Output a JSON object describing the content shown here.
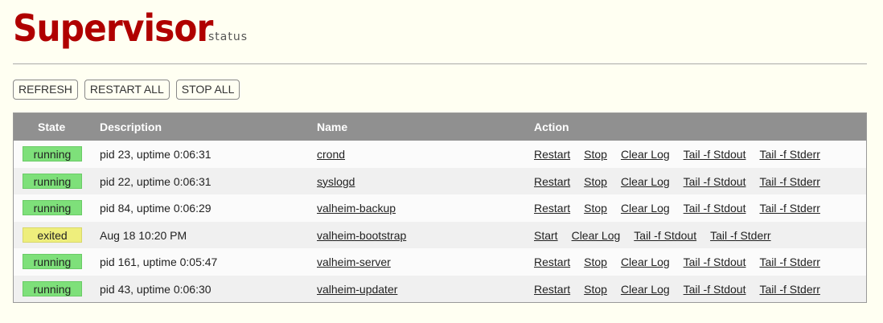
{
  "header": {
    "logo": "Supervisor",
    "subtitle": "status"
  },
  "toolbar": {
    "refresh_label": "REFRESH",
    "restart_all_label": "RESTART ALL",
    "stop_all_label": "STOP ALL"
  },
  "table": {
    "columns": {
      "state": "State",
      "description": "Description",
      "name": "Name",
      "action": "Action"
    },
    "rows": [
      {
        "state": "running",
        "description": "pid 23, uptime 0:06:31",
        "name": "crond",
        "actions": [
          "Restart",
          "Stop",
          "Clear Log",
          "Tail -f Stdout",
          "Tail -f Stderr"
        ]
      },
      {
        "state": "running",
        "description": "pid 22, uptime 0:06:31",
        "name": "syslogd",
        "actions": [
          "Restart",
          "Stop",
          "Clear Log",
          "Tail -f Stdout",
          "Tail -f Stderr"
        ]
      },
      {
        "state": "running",
        "description": "pid 84, uptime 0:06:29",
        "name": "valheim-backup",
        "actions": [
          "Restart",
          "Stop",
          "Clear Log",
          "Tail -f Stdout",
          "Tail -f Stderr"
        ]
      },
      {
        "state": "exited",
        "description": "Aug 18 10:20 PM",
        "name": "valheim-bootstrap",
        "actions": [
          "Start",
          "Clear Log",
          "Tail -f Stdout",
          "Tail -f Stderr"
        ]
      },
      {
        "state": "running",
        "description": "pid 161, uptime 0:05:47",
        "name": "valheim-server",
        "actions": [
          "Restart",
          "Stop",
          "Clear Log",
          "Tail -f Stdout",
          "Tail -f Stderr"
        ]
      },
      {
        "state": "running",
        "description": "pid 43, uptime 0:06:30",
        "name": "valheim-updater",
        "actions": [
          "Restart",
          "Stop",
          "Clear Log",
          "Tail -f Stdout",
          "Tail -f Stderr"
        ]
      }
    ]
  },
  "colors": {
    "background": "#fffff2",
    "logo": "#b00000",
    "header_bg": "#909090",
    "running": "#7ee07a",
    "exited": "#eeee7c"
  }
}
